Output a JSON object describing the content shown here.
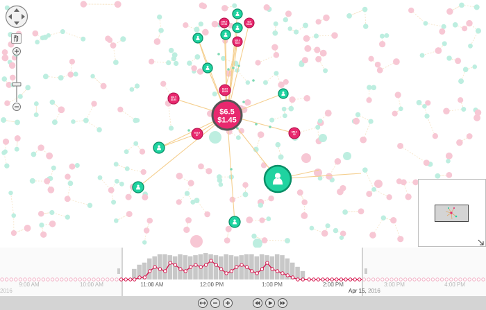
{
  "network": {
    "hub": {
      "line1": "$6.5",
      "line2": "$1.45"
    },
    "price_nodes": [
      {
        "id": "p1",
        "line1": "$50.0",
        "line2": "$7.95"
      },
      {
        "id": "p2",
        "line1": "$10",
        "line2": "$6.85"
      },
      {
        "id": "p3",
        "line1": "$30.0",
        "line2": "$8.8"
      },
      {
        "id": "p4",
        "line1": "$16.5",
        "line2": "$5.85"
      },
      {
        "id": "p5",
        "line1": "$30.5",
        "line2": "$3.95"
      },
      {
        "id": "p6",
        "line1": "$21.6",
        "line2": "$7"
      },
      {
        "id": "p7",
        "line1": "$50.0",
        "line2": "$2"
      }
    ]
  },
  "timebar": {
    "ticks": [
      "9:00 AM",
      "10:00 AM",
      "11:00 AM",
      "12:00 PM",
      "1:00 PM",
      "2:00 PM",
      "3:00 PM",
      "4:00 PM"
    ],
    "date_left": "2016",
    "date_right": "Apr 15, 2016",
    "date_far": "2016",
    "histogram": [
      10,
      14,
      16,
      20,
      22,
      24,
      24,
      23,
      22,
      24,
      23,
      22,
      23,
      24,
      25,
      24,
      23,
      22,
      24,
      23,
      22,
      23,
      24,
      24,
      22,
      24,
      23,
      22,
      24,
      23,
      20,
      16,
      12,
      8
    ],
    "line_series": [
      0,
      1,
      1,
      4,
      6,
      5,
      4,
      8,
      7,
      5,
      4,
      6,
      7,
      6,
      7,
      9,
      7,
      5,
      3,
      4,
      6,
      7,
      6,
      4,
      3,
      5,
      8,
      5,
      4,
      3,
      2,
      1,
      0,
      0
    ],
    "controls": [
      "fit-icon",
      "zoom-out-icon",
      "zoom-in-icon",
      "step-back-icon",
      "play-icon",
      "step-forward-icon"
    ]
  },
  "colors": {
    "green": "#1fd3a0",
    "green_dark": "#0a8f67",
    "pink": "#e8286e",
    "pink_dark": "#b0104a",
    "faded_green": "#bdeee0",
    "faded_pink": "#f7c7d4",
    "link": "#f5cf8f"
  }
}
